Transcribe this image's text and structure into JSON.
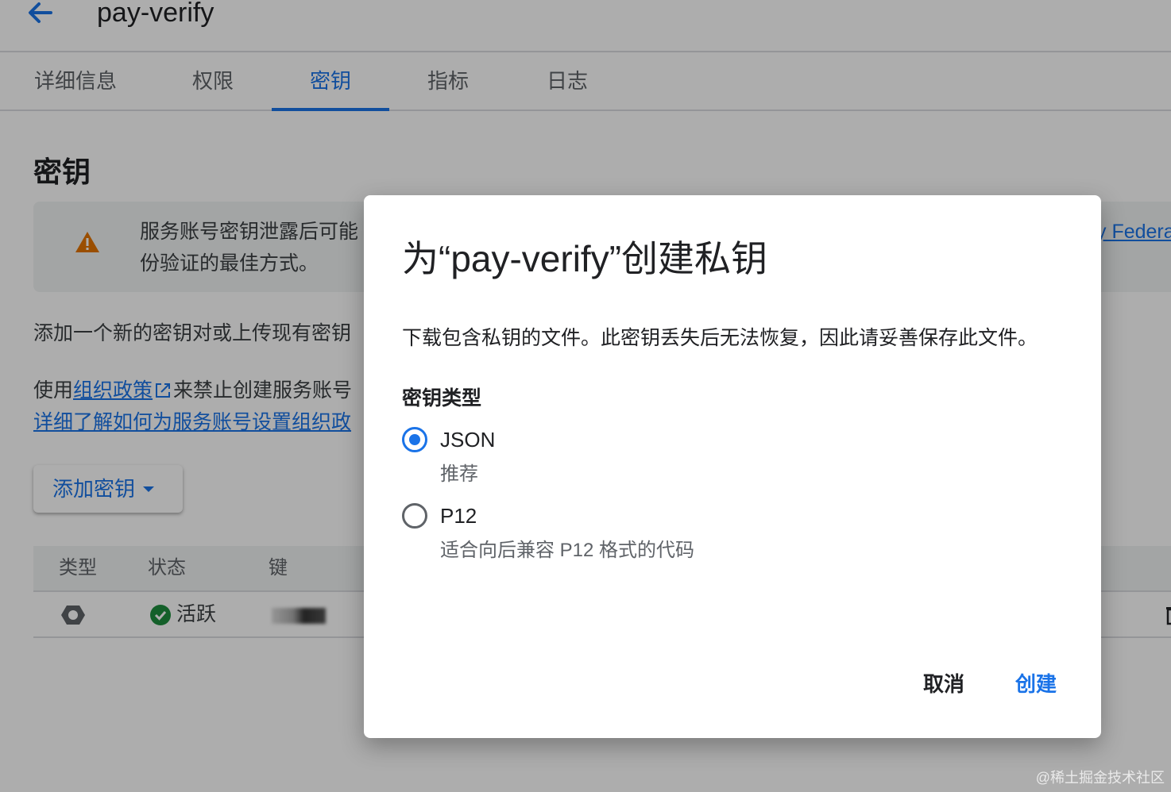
{
  "header": {
    "title": "pay-verify",
    "back_icon": "arrow-back-icon"
  },
  "tabs": [
    {
      "label": "详细信息",
      "active": false
    },
    {
      "label": "权限",
      "active": false
    },
    {
      "label": "密钥",
      "active": true
    },
    {
      "label": "指标",
      "active": false
    },
    {
      "label": "日志",
      "active": false
    }
  ],
  "section": {
    "title": "密钥",
    "warning_line1": "服务账号密钥泄露后可能",
    "warning_line2": "份验证的最佳方式。",
    "warning_link": "y Federa",
    "para1": "添加一个新的密钥对或上传现有密钥",
    "para2_prefix": "使用",
    "para2_link": "组织政策",
    "para2_suffix": "来禁止创建服务账号",
    "para3_link": "详细了解如何为服务账号设置组织政",
    "add_key_button": "添加密钥"
  },
  "table": {
    "headers": [
      "类型",
      "状态",
      "键"
    ],
    "rows": [
      {
        "status": "活跃"
      }
    ]
  },
  "dialog": {
    "title": "为“pay-verify”创建私钥",
    "description": "下载包含私钥的文件。此密钥丢失后无法恢复，因此请妥善保存此文件。",
    "key_type_label": "密钥类型",
    "options": [
      {
        "label": "JSON",
        "hint": "推荐",
        "selected": true
      },
      {
        "label": "P12",
        "hint": "适合向后兼容 P12 格式的代码",
        "selected": false
      }
    ],
    "cancel_label": "取消",
    "create_label": "创建"
  },
  "watermark": "@稀土掘金技术社区",
  "colors": {
    "accent": "#1a73e8",
    "warning": "#e37400",
    "success": "#1e8e3e"
  }
}
